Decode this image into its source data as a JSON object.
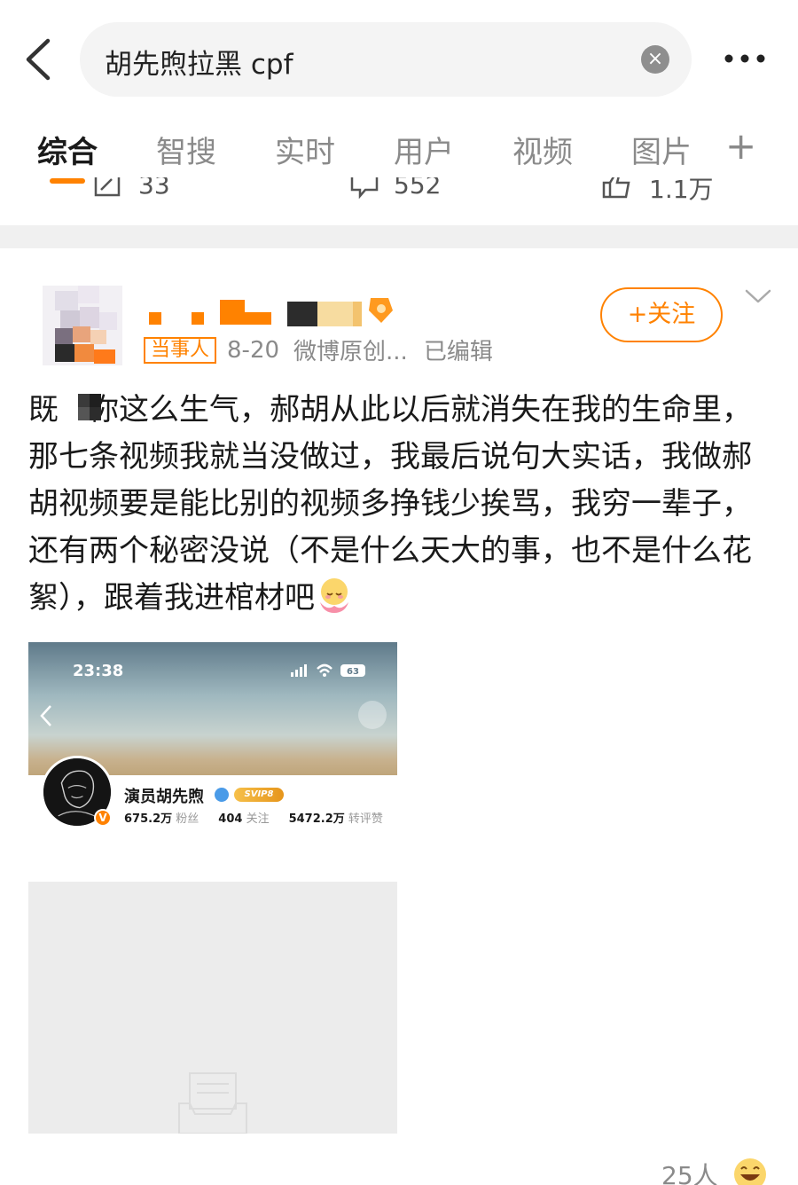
{
  "header": {
    "search_query": "胡先煦拉黑 cpf",
    "clear_icon": "close-circle-icon",
    "more_icon": "more-dots-icon"
  },
  "tabs": [
    {
      "label": "综合",
      "active": true
    },
    {
      "label": "智搜",
      "active": false
    },
    {
      "label": "实时",
      "active": false
    },
    {
      "label": "用户",
      "active": false
    },
    {
      "label": "视频",
      "active": false
    },
    {
      "label": "图片",
      "active": false
    }
  ],
  "tabs_add_label": "+",
  "previous_post_stats": {
    "reposts": "33",
    "comments": "552",
    "likes": "1.1万"
  },
  "post": {
    "follow_label": "+关注",
    "badge": "当事人",
    "time": "8-20",
    "source": "微博原创...",
    "edited": "已编辑",
    "text_lead": "既",
    "text_body": "你这么生气，郝胡从此以后就消失在我的生命里，那七条视频我就当没做过，我最后说句大实话，我做郝胡视频要是能比别的视频多挣钱少挨骂，我穷一辈子，还有两个秘密没说（不是什么天大的事，也不是什么花絮），跟着我进棺材吧",
    "like_count": "25人"
  },
  "embedded_screenshot": {
    "clock": "23:38",
    "battery": "63",
    "profile_name": "演员胡先煦",
    "svip_label": "SVIP8",
    "followers_value": "675.2万",
    "followers_label": "粉丝",
    "following_value": "404",
    "following_label": "关注",
    "interactions_value": "5472.2万",
    "interactions_label": "转评赞"
  },
  "colors": {
    "accent": "#ff8200",
    "muted_text": "#8a8a8a",
    "search_bg": "#f4f4f4"
  }
}
